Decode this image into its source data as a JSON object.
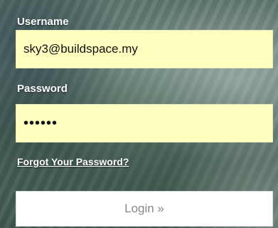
{
  "login_form": {
    "username_label": "Username",
    "username_value": "sky3@buildspace.my",
    "password_label": "Password",
    "password_value": "••••••",
    "forgot_link": "Forgot Your Password?",
    "login_button": "Login »"
  },
  "colors": {
    "input_background": "#ffffc0",
    "label_text": "#ffffff",
    "button_background": "#ffffff",
    "button_text": "#888888"
  }
}
